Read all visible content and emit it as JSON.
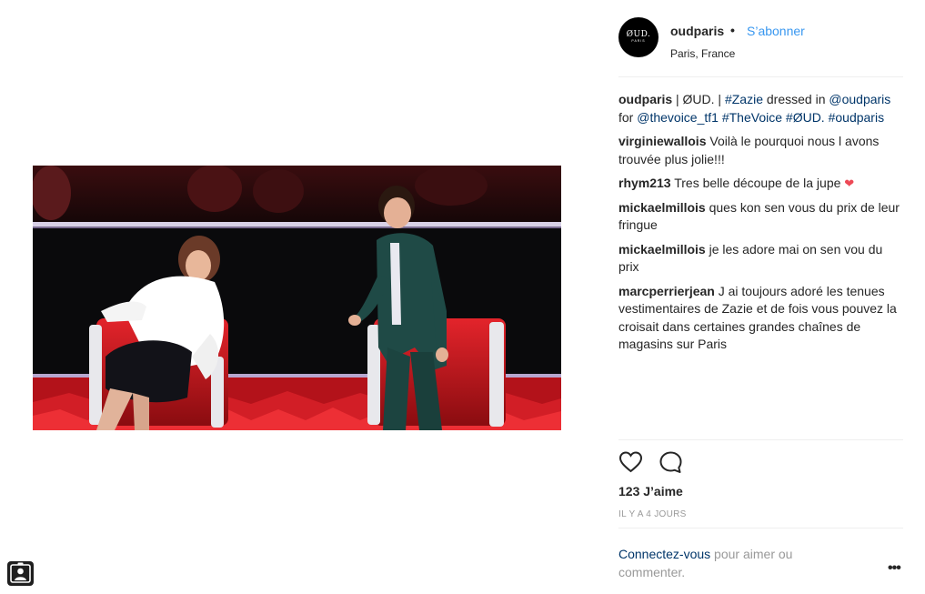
{
  "post": {
    "username": "oudparis",
    "follow_label": "S’abonner",
    "location": "Paris, France",
    "avatar_logo": "ØUD.",
    "avatar_sub": "PARIS"
  },
  "caption": {
    "author": "oudparis",
    "parts": [
      " | ØUD. | ",
      "#Zazie",
      " dressed in ",
      "@oudparis",
      " for ",
      "@thevoice_tf1",
      " ",
      "#TheVoice",
      " ",
      "#ØUD.",
      " ",
      "#oudparis"
    ]
  },
  "comments": [
    {
      "author": "virginiewallois",
      "text": "Voilà le pourquoi nous l avons trouvée plus jolie!!!"
    },
    {
      "author": "rhym213",
      "text": "Tres belle découpe de la jupe",
      "emoji": "❤"
    },
    {
      "author": "mickaelmillois",
      "text": "ques kon sen vous du prix de leur fringue"
    },
    {
      "author": "mickaelmillois",
      "text": "je les adore mai on sen vou du prix"
    },
    {
      "author": "marcperrierjean",
      "text": "J ai toujours adoré les tenues vestimentaires de Zazie et de fois vous pouvez la croisait dans certaines grandes chaînes de magasins sur Paris"
    }
  ],
  "stats": {
    "likes": "123 J’aime",
    "timestamp": "IL Y A 4 JOURS"
  },
  "login": {
    "link": "Connectez-vous",
    "rest": " pour aimer ou commenter."
  },
  "more_label": "•••",
  "icons": {
    "like": "heart-outline-icon",
    "comment": "speech-bubble-icon",
    "profile": "person-icon"
  },
  "colors": {
    "link_blue": "#3897f0",
    "tag_navy": "#003569",
    "muted": "#999999",
    "stage_red": "#c4141a"
  }
}
